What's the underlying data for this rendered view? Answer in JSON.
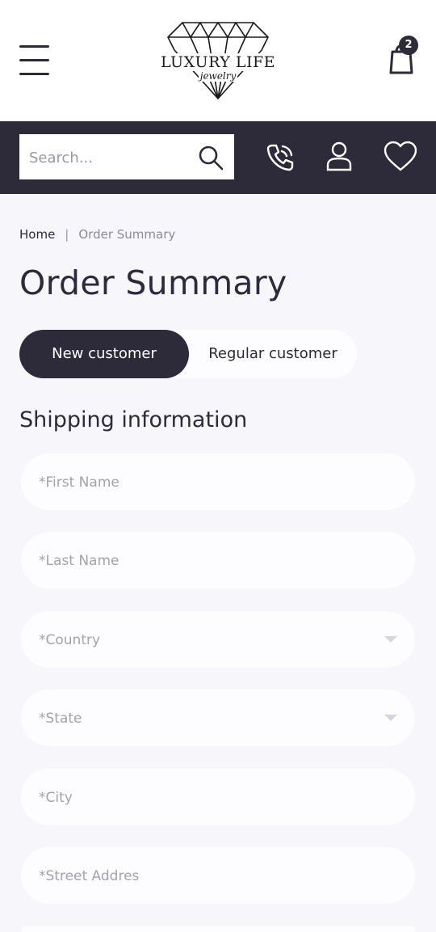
{
  "header": {
    "logo_text": "LUXURY LIFE",
    "logo_subtext": "jewelry",
    "cart_count": "2"
  },
  "search": {
    "placeholder": "Search..."
  },
  "breadcrumb": {
    "home": "Home",
    "separator": "|",
    "current": "Order Summary"
  },
  "page": {
    "title": "Order Summary"
  },
  "customer_toggle": {
    "new_label": "New customer",
    "regular_label": "Regular customer",
    "selected": "New customer"
  },
  "shipping": {
    "title": "Shipping information",
    "fields": [
      {
        "placeholder": "*First Name"
      },
      {
        "placeholder": "*Last Name"
      },
      {
        "placeholder": "*Country"
      },
      {
        "placeholder": "*State"
      },
      {
        "placeholder": "*City"
      },
      {
        "placeholder": "*Street Addres"
      }
    ]
  },
  "colors": {
    "primary": "#2d2a3a",
    "background": "#f7f6fb",
    "field_background": "#fdfcff",
    "white": "#ffffff"
  },
  "icons": [
    "menu-icon",
    "diamond-logo-icon",
    "cart-icon",
    "search-icon",
    "phone-icon",
    "user-icon",
    "heart-icon",
    "chevron-down-icon"
  ]
}
